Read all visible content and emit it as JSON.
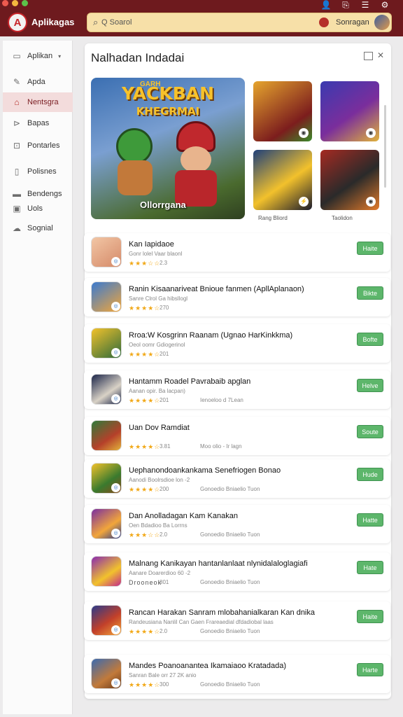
{
  "colors": {
    "topbar": "#6e1a1e",
    "accent": "#c7252a",
    "install_button": "#5db66b",
    "star": "#f1a817",
    "search_bg": "#f7e0a8"
  },
  "app": {
    "title": "Aplikagas"
  },
  "search": {
    "value": "Q Soarol"
  },
  "user": {
    "name": "Sonragan"
  },
  "sidebar": {
    "items": [
      {
        "label": "Aplikan",
        "icon": "window-icon"
      },
      {
        "label": "Apda",
        "icon": "pencil-icon"
      },
      {
        "label": "Nentsgra",
        "icon": "home-icon"
      },
      {
        "label": "Bapas",
        "icon": "tag-icon"
      },
      {
        "label": "Pontarles",
        "icon": "grid-icon"
      },
      {
        "label": "Polisnes",
        "icon": "document-icon"
      },
      {
        "label": "Bendengs",
        "icon": "folder-icon"
      },
      {
        "label": "Uols",
        "icon": "image-icon"
      },
      {
        "label": "Sognial",
        "icon": "cloud-icon"
      }
    ]
  },
  "panel": {
    "title": "Nalhadan Indadai"
  },
  "featured": {
    "headline": "YACKBAN",
    "subheadline": "KHEGRMAI",
    "top_line": "GARH",
    "caption": "Ollorrgana",
    "thumb_caption_1": "Rang Bliord",
    "thumb_caption_2": "Taolidon"
  },
  "list": [
    {
      "title": "Kan Iapidaoe",
      "sub": "Gonr lolel Vaar blaonl",
      "stars": "★★★☆☆",
      "rating": "2.3",
      "meta": "",
      "button": "Haite"
    },
    {
      "title": "Ranin Kisaanariveat Bnioue fanmen (ApllAplanaon)",
      "sub": "Sanre Clrol Ga hibsllogl",
      "stars": "★★★★☆",
      "rating": "270",
      "meta": "",
      "button": "Bikte"
    },
    {
      "title": "Rroa:W Kosgrinn Raanam (Ugnao HarKinkkma)",
      "sub": "Oeol oomr Gdiogerinol",
      "stars": "★★★★☆",
      "rating": "201",
      "meta": "",
      "button": "Bofte"
    },
    {
      "title": "Hantamm Roadel Pavrabaib apglan",
      "sub": "Aanan opir. Ba lacpan)",
      "stars": "★★★★☆",
      "rating": "201",
      "meta": "Ienoeloo d 7Lean",
      "button": "Helve"
    },
    {
      "title": "Uan Dov Ramdiat",
      "sub": "",
      "stars": "★★★★☆",
      "rating": "3.81",
      "meta": "Moo olio - Ir lagn",
      "button": "Soute"
    },
    {
      "title": "Uephanondoankankama Senefriogen Bonao",
      "sub": "Aanodi Boolrsdioe lon -2",
      "stars": "★★★★☆",
      "rating": "200",
      "meta": "Gonoedio Bniaelio Tuon",
      "button": "Hude"
    },
    {
      "title": "Dan Anolladagan Kam Kanakan",
      "sub": "Oen Bdadioo Ba Lorrns",
      "stars": "★★★☆☆",
      "rating": "2.0",
      "meta": "Gonoedio Bniaelio Tuon",
      "button": "Hatte"
    },
    {
      "title": "Malnang Kanikayan hantanlanlaat nlynidalaloglagiafi",
      "sub": "Aanare Doarerdioo 60 -2",
      "stars": "Drooneok",
      "rating": "801",
      "meta": "Gonoedio Bniaelio Tuon",
      "button": "Hate"
    },
    {
      "title": "Rancan Harakan Sanram mlobahanialkaran Kan dnika",
      "sub": "Randeusiana Nanlil Can Gaen Frareaedial dfdadiobal laas",
      "stars": "★★★★☆",
      "rating": "2.0",
      "meta": "Gonoedio Bniaelio Tuon",
      "button": "Haite"
    },
    {
      "title": "Mandes Poanoanantea Ikamaiaoo Kratadada)",
      "sub": "Sanran Bale orr 27 2K anio",
      "stars": "★★★★☆",
      "rating": "300",
      "meta": "Gonoedio Bniaelio Tuon",
      "button": "Harte"
    }
  ]
}
